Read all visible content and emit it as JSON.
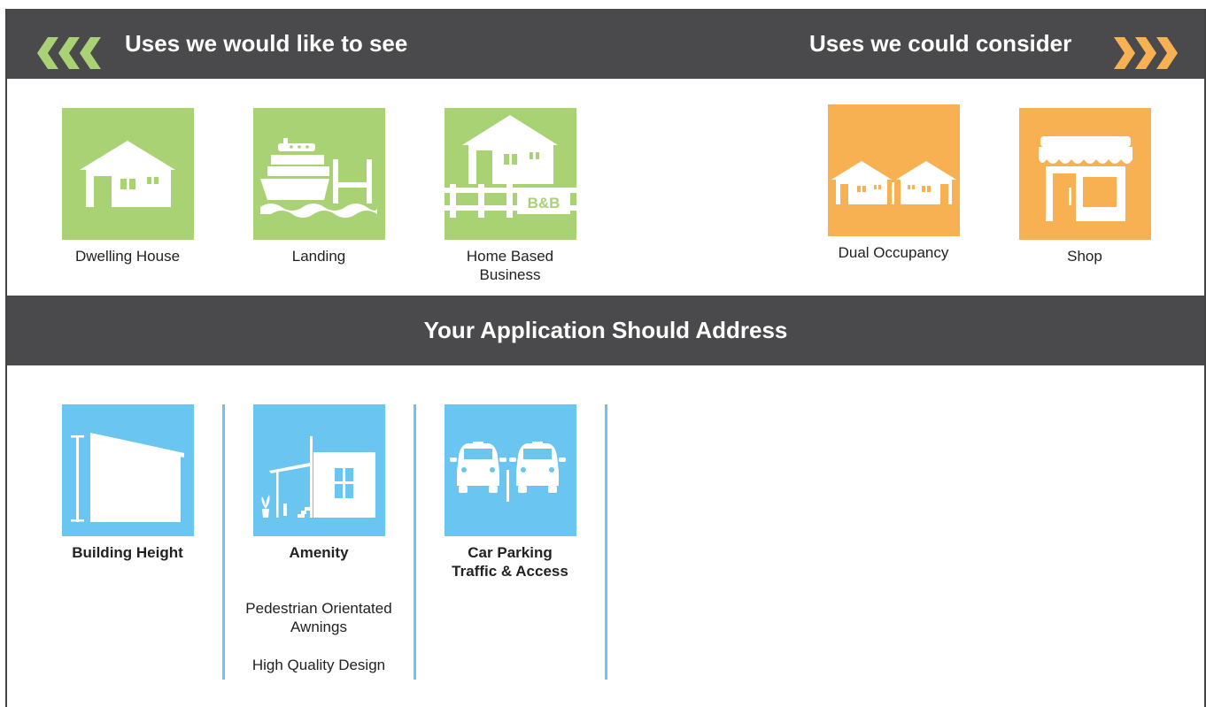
{
  "header": {
    "left_title": "Uses we would like to see",
    "right_title": "Uses we could consider"
  },
  "preferred_uses": [
    {
      "label": "Dwelling House",
      "icon": "house-icon"
    },
    {
      "label": "Landing",
      "icon": "boat-landing-icon"
    },
    {
      "label": "Home Based Business",
      "label_line1": "Home Based",
      "label_line2": "Business",
      "icon": "bnb-house-icon",
      "sign_text": "B&B"
    }
  ],
  "considered_uses": [
    {
      "label": "Dual Occupancy",
      "icon": "dual-house-icon"
    },
    {
      "label": "Shop",
      "icon": "shop-icon"
    }
  ],
  "section": {
    "title": "Your Application Should Address"
  },
  "address_items": [
    {
      "title": "Building Height",
      "icon": "building-height-icon"
    },
    {
      "title": "Amenity",
      "icon": "amenity-icon",
      "notes": [
        "Pedestrian Orientated",
        "Awnings",
        "High Quality Design"
      ]
    },
    {
      "title_line1": "Car Parking",
      "title_line2": "Traffic & Access",
      "icon": "car-parking-icon"
    }
  ],
  "colors": {
    "green": "#a9d274",
    "orange": "#f7b152",
    "blue": "#6ac5f0",
    "bar": "#4a4a4c"
  }
}
